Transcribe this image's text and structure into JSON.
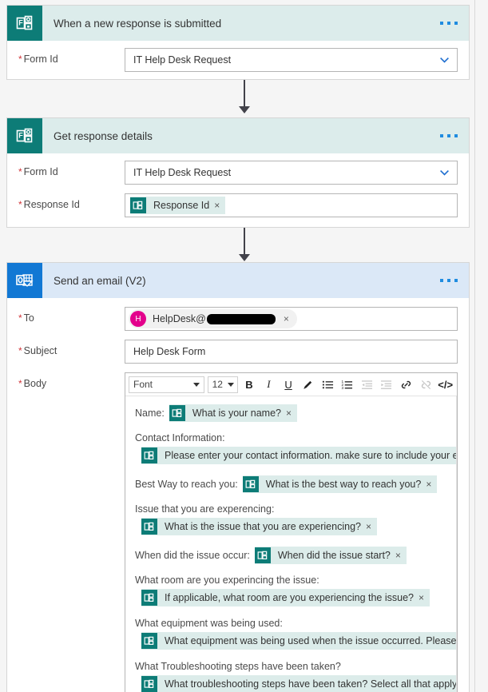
{
  "flow": {
    "steps": [
      {
        "title": "When a new response is submitted",
        "app_icon": "microsoft-forms-icon",
        "menu": "ellipsis-menu",
        "fields": [
          {
            "label": "Form Id",
            "required": true,
            "type": "dropdown",
            "value": "IT Help Desk Request"
          }
        ]
      },
      {
        "title": "Get response details",
        "app_icon": "microsoft-forms-icon",
        "menu": "ellipsis-menu",
        "fields": [
          {
            "label": "Form Id",
            "required": true,
            "type": "dropdown",
            "value": "IT Help Desk Request"
          },
          {
            "label": "Response Id",
            "required": true,
            "type": "token",
            "token": "Response Id",
            "remove": "×"
          }
        ]
      },
      {
        "title": "Send an email (V2)",
        "app_icon": "outlook-icon",
        "menu": "ellipsis-menu",
        "fields": [
          {
            "label": "To",
            "required": true,
            "type": "recipient",
            "avatar_initial": "H",
            "value": "HelpDesk@",
            "redacted": true,
            "remove": "×"
          },
          {
            "label": "Subject",
            "required": true,
            "type": "text",
            "value": "Help Desk Form"
          },
          {
            "label": "Body",
            "required": true,
            "type": "richtext"
          }
        ]
      }
    ]
  },
  "editor": {
    "toolbar": {
      "font_label": "Font",
      "size_label": "12",
      "bold": "B",
      "italic": "I",
      "underline": "U",
      "code": "</>"
    },
    "blocks": [
      {
        "layout": "inline",
        "label": "Name:",
        "token": "What is your name?",
        "remove": "×"
      },
      {
        "layout": "stacked",
        "label": "Contact Information:",
        "token": "Please enter your contact information. make sure to include your email a",
        "remove": ""
      },
      {
        "layout": "inline",
        "label": "Best Way to reach you:",
        "token": "What is the best way to reach you?",
        "remove": "×"
      },
      {
        "layout": "stacked",
        "label": "Issue that you are experencing:",
        "token": "What is the issue that you are experiencing?",
        "remove": "×"
      },
      {
        "layout": "inline",
        "label": "When did the issue occur:",
        "token": "When did the issue start?",
        "remove": "×"
      },
      {
        "layout": "stacked",
        "label": "What room are you experincing the issue:",
        "token": "If applicable, what room are you experiencing the issue?",
        "remove": "×"
      },
      {
        "layout": "stacked",
        "label": "What equipment was being used:",
        "token": "What equipment was being used when the issue occurred. Please notate",
        "remove": ""
      },
      {
        "layout": "stacked",
        "label": "What Troubleshooting steps have been taken?",
        "token": "What troubleshooting steps have been taken? Select all that apply",
        "remove": ""
      }
    ]
  },
  "colors": {
    "forms_accent": "#0d7c77",
    "forms_header": "#dceceb",
    "outlook_accent": "#1278d4",
    "outlook_header": "#dbe8f7",
    "required_asterisk": "#d13438",
    "token_bg": "#dcecea",
    "avatar_bg": "#e3008c",
    "menu_dot": "#1f8ce0",
    "connector": "#42424a"
  }
}
